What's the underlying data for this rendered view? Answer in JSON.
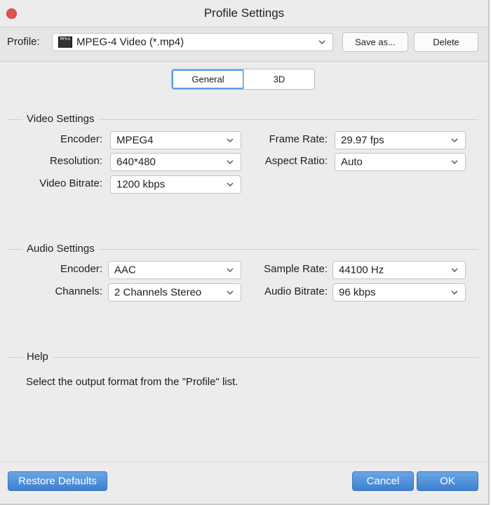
{
  "window": {
    "title": "Profile Settings"
  },
  "profile": {
    "label": "Profile:",
    "value": "MPEG-4 Video (*.mp4)",
    "icon": "mpeg-file-icon",
    "icon_text": "MPEG",
    "save_as": "Save as...",
    "delete": "Delete"
  },
  "tabs": [
    {
      "label": "General",
      "active": true
    },
    {
      "label": "3D",
      "active": false
    }
  ],
  "video": {
    "title": "Video Settings",
    "encoder_label": "Encoder:",
    "encoder": "MPEG4",
    "resolution_label": "Resolution:",
    "resolution": "640*480",
    "bitrate_label": "Video Bitrate:",
    "bitrate": "1200 kbps",
    "framerate_label": "Frame Rate:",
    "framerate": "29.97 fps",
    "aspect_label": "Aspect Ratio:",
    "aspect": "Auto"
  },
  "audio": {
    "title": "Audio Settings",
    "encoder_label": "Encoder:",
    "encoder": "AAC",
    "channels_label": "Channels:",
    "channels": "2 Channels Stereo",
    "samplerate_label": "Sample Rate:",
    "samplerate": "44100 Hz",
    "bitrate_label": "Audio Bitrate:",
    "bitrate": "96 kbps"
  },
  "help": {
    "title": "Help",
    "text": "Select the output format from the \"Profile\" list."
  },
  "footer": {
    "restore": "Restore Defaults",
    "cancel": "Cancel",
    "ok": "OK"
  },
  "colors": {
    "accent": "#4a8cdb",
    "close": "#e0534a",
    "background": "#ececec"
  }
}
